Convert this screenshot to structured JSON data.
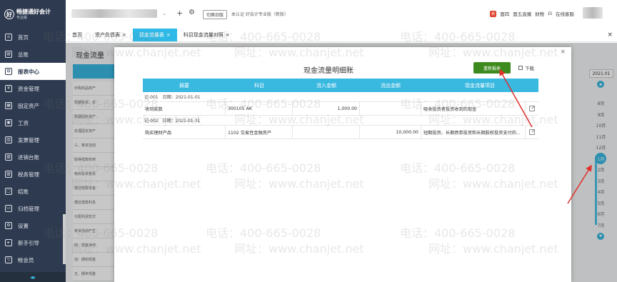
{
  "app": {
    "logo_text": "畅捷通好会计",
    "logo_sub": "专业版",
    "edition": "本认证 好会计专业版（新版）",
    "switch_label": "切换旧版"
  },
  "topbar": {
    "news_badge": "新",
    "links": [
      "面四",
      "面五直播",
      "财税"
    ],
    "online_service": "在线客服"
  },
  "sidebar": {
    "items": [
      {
        "label": "首页",
        "icon": "home-icon"
      },
      {
        "label": "总账",
        "icon": "ledger-icon"
      },
      {
        "label": "报表中心",
        "icon": "report-icon",
        "active": true
      },
      {
        "label": "资金管理",
        "icon": "money-icon"
      },
      {
        "label": "固定资产",
        "icon": "asset-icon"
      },
      {
        "label": "工资",
        "icon": "salary-icon"
      },
      {
        "label": "发票管理",
        "icon": "invoice-icon"
      },
      {
        "label": "进销台账",
        "icon": "inventory-icon"
      },
      {
        "label": "税务管理",
        "icon": "tax-icon"
      },
      {
        "label": "结账",
        "icon": "closing-icon"
      },
      {
        "label": "归档管理",
        "icon": "archive-icon"
      },
      {
        "label": "设置",
        "icon": "settings-icon"
      },
      {
        "label": "新手引导",
        "icon": "guide-icon"
      },
      {
        "label": "帐会员",
        "icon": "vip-icon"
      }
    ]
  },
  "tabs": [
    {
      "label": "首页",
      "closable": false
    },
    {
      "label": "资产负债表",
      "closable": true
    },
    {
      "label": "现金流量表",
      "closable": true,
      "active": true
    },
    {
      "label": "科目现金流量对照",
      "closable": true
    }
  ],
  "page": {
    "title": "现金流量",
    "bg_rows": [
      "外购商品收产",
      "短期投资、长",
      "购建固定资产",
      "处理固定资产",
      "三、筹资活动",
      "取得借款收到",
      "吸收投资者投",
      "偿还借款本金",
      "偿还借款利息",
      "分配利润支付",
      "筹资活动产生",
      "四、现金净增",
      "加：期初现金",
      "五、期末现金"
    ]
  },
  "calendar": {
    "year": "2021.01",
    "months": [
      "8月",
      "9月",
      "10月",
      "11月",
      "12月",
      "1月",
      "2月",
      "3月",
      "4月",
      "5月",
      "6月",
      "7月"
    ],
    "active_month": "1月"
  },
  "modal": {
    "title": "现金流量明细账",
    "regen_label": "重新报表",
    "download_label": "下载",
    "columns": [
      "摘要",
      "科目",
      "流入金额",
      "流出金额",
      "现金流量项目"
    ],
    "groups": [
      {
        "voucher": "记-001",
        "date_label": "日期：2021-01-01",
        "rows": [
          {
            "summary": "收到款数",
            "subject": "300105 AK",
            "inflow": "1,000.00",
            "outflow": "",
            "item": "吸收投资者投资收到的现金"
          }
        ]
      },
      {
        "voucher": "记-002",
        "date_label": "日期：2021-01-31",
        "rows": [
          {
            "summary": "购买理财产品",
            "subject": "1102 交易性金融资产",
            "inflow": "",
            "outflow": "10,000.00",
            "item": "短期投资、长期债券投资和长期股权投资支付的..."
          }
        ]
      }
    ]
  },
  "watermark": {
    "phone": "电话：400-665-0028",
    "site": "网址：www.chanjet.net"
  },
  "colors": {
    "sidebar": "#2e3a4f",
    "accent": "#39b8e0",
    "regen_button": "#3d8b1e",
    "arrow": "#e0302a"
  }
}
